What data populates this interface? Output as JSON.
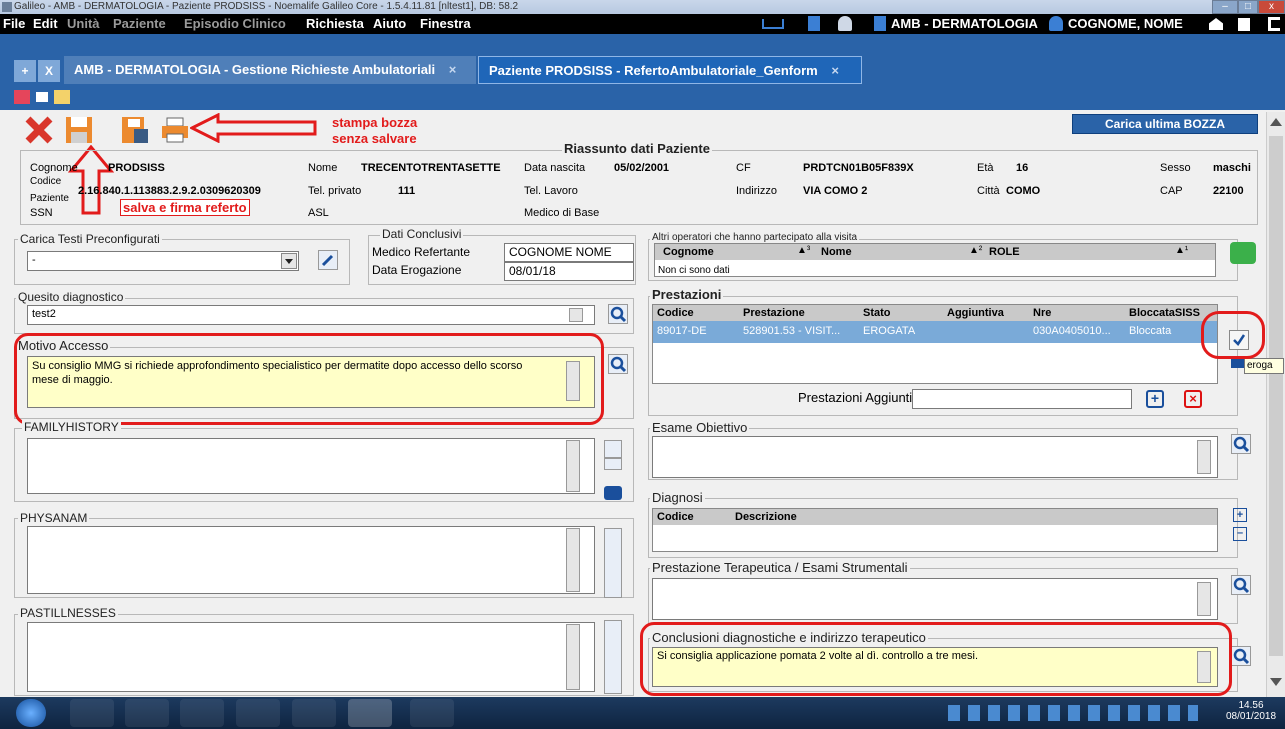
{
  "window": {
    "title": "Galileo - AMB - DERMATOLOGIA - Paziente PRODSISS - Noemalife Galileo Core - 1.5.4.11.81 [nltest1], DB: 58.2",
    "controls": [
      "–",
      "□",
      "x"
    ]
  },
  "menubar": {
    "items": [
      "File",
      "Edit",
      "Unità",
      "Paziente",
      "Episodio Clinico",
      "Richiesta",
      "Aiuto",
      "Finestra"
    ],
    "ward": "AMB - DERMATOLOGIA",
    "user": "COGNOME, NOME"
  },
  "tabs": {
    "plus": "+",
    "close": "X",
    "tab1": "AMB - DERMATOLOGIA - Gestione Richieste Ambulatoriali",
    "tab2": "Paziente PRODSISS - RefertoAmbulatoriale_Genform",
    "x": "×"
  },
  "annotations": {
    "stampa": "stampa bozza",
    "senza": "senza salvare",
    "salva": "salva e firma referto"
  },
  "carica_button": "Carica ultima BOZZA",
  "riassunto": {
    "title": "Riassunto dati Paziente",
    "cognome_label": "Cognome",
    "cognome": "PRODSISS",
    "nome_label": "Nome",
    "nome": "TRECENTOTRENTASETTE",
    "nascita_label": "Data nascita",
    "nascita": "05/02/2001",
    "cf_label": "CF",
    "cf": "PRDTCN01B05F839X",
    "eta_label": "Età",
    "eta": "16",
    "sesso_label": "Sesso",
    "sesso": "maschi",
    "codice_label": "Codice",
    "paziente_label": "Paziente",
    "codice": "2.16.840.1.113883.2.9.2.0309620309",
    "telpriv_label": "Tel. privato",
    "telpriv": "111",
    "tellav_label": "Tel. Lavoro",
    "indirizzo_label": "Indirizzo",
    "indirizzo": "VIA COMO 2",
    "citta_label": "Città",
    "citta": "COMO",
    "cap_label": "CAP",
    "cap": "22100",
    "ssn_label": "SSN",
    "asl_label": "ASL",
    "medico_label": "Medico di Base"
  },
  "testi": {
    "label": "Carica Testi Preconfigurati",
    "value": "-"
  },
  "conclusivi": {
    "label": "Dati Conclusivi",
    "medico_label": "Medico Refertante",
    "medico": "COGNOME NOME",
    "data_label": "Data Erogazione",
    "data": "08/01/18"
  },
  "operatori": {
    "label": "Altri operatori che hanno partecipato alla visita",
    "col1": "Cognome",
    "col1_sort": "▲³",
    "col2": "Nome",
    "col2_sort": "▲²",
    "col3": "ROLE",
    "col3_sort": "▲¹",
    "empty": "Non ci sono dati"
  },
  "quesito": {
    "label": "Quesito diagnostico",
    "value": "test2"
  },
  "prestazioni": {
    "label": "Prestazioni",
    "columns": [
      "Codice",
      "Prestazione",
      "Stato",
      "Aggiuntiva",
      "Nre",
      "BloccataSISS"
    ],
    "row": [
      "89017-DE",
      "528901.53 - VISIT...",
      "EROGATA",
      "",
      "030A0405010...",
      "Bloccata"
    ],
    "aggiuntive_label": "Prestazioni Aggiuntive",
    "eroga": "eroga"
  },
  "motivo": {
    "label": "Motivo Accesso",
    "line1": "Su consiglio MMG si richiede approfondimento specialistico per dermatite dopo accesso dello scorso",
    "line2": "mese di maggio."
  },
  "family": {
    "label": "FAMILYHISTORY"
  },
  "esame": {
    "label": "Esame Obiettivo"
  },
  "diagnosi": {
    "label": "Diagnosi",
    "col1": "Codice",
    "col2": "Descrizione"
  },
  "physanam": {
    "label": "PHYSANAM"
  },
  "terapeutica": {
    "label": "Prestazione Terapeutica / Esami Strumentali"
  },
  "pastill": {
    "label": "PASTILLNESSES"
  },
  "conclusioni": {
    "label": "Conclusioni diagnostiche e indirizzo terapeutico",
    "value": "Si consiglia applicazione pomata 2 volte al dì. controllo a tre mesi."
  },
  "taskbar": {
    "time": "14.56",
    "date": "08/01/2018"
  },
  "colors": {
    "accent": "#2a63a8",
    "annotation_red": "#e21b1b",
    "yellow_field": "#ffffc8",
    "selected_row": "#7aaad8"
  }
}
